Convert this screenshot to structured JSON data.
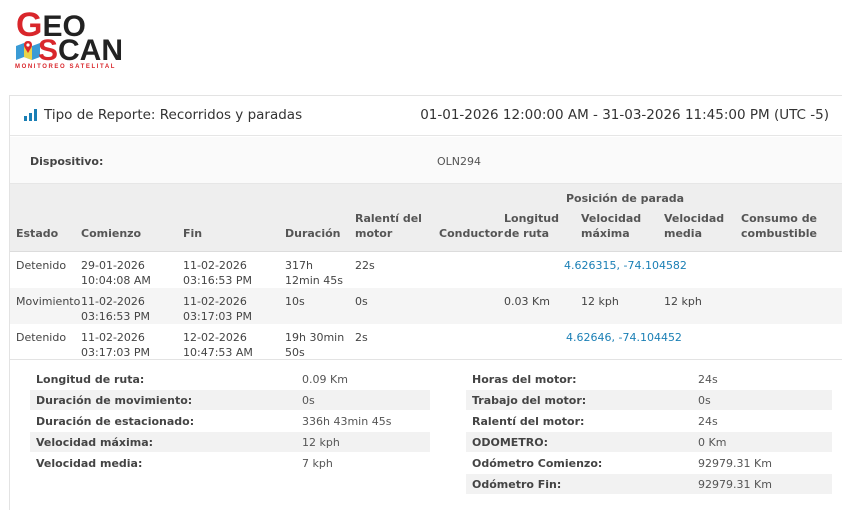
{
  "logo": {
    "line1": "GEO",
    "line2": "SCAN",
    "tagline": "MONITOREO SATELITAL",
    "brand_red": "#d9262b"
  },
  "report": {
    "icon": "bar-chart-icon",
    "title": "Tipo de Reporte: Recorridos y paradas",
    "range": "01-01-2026 12:00:00 AM - 31-03-2026 11:45:00 PM (UTC -5)"
  },
  "device": {
    "label": "Dispositivo:",
    "value": "OLN294"
  },
  "table": {
    "group_header": "Posición de parada",
    "headers": {
      "estado": "Estado",
      "comienzo": "Comienzo",
      "fin": "Fin",
      "duracion": "Duración",
      "ralenti": "Ralentí del motor",
      "conductor": "Conductor",
      "longitud": "Longitud de ruta",
      "vel_max": "Velocidad máxima",
      "vel_media": "Velocidad media",
      "consumo": "Consumo de combustible"
    },
    "rows": [
      {
        "estado": "Detenido",
        "comienzo": "29-01-2026 10:04:08 AM",
        "fin": "11-02-2026 03:16:53 PM",
        "duracion": "317h 12min 45s",
        "ralenti": "22s",
        "posicion": "4.626315, -74.104582"
      },
      {
        "estado": "Movimiento",
        "comienzo": "11-02-2026 03:16:53 PM",
        "fin": "11-02-2026 03:17:03 PM",
        "duracion": "10s",
        "ralenti": "0s",
        "longitud": "0.03 Km",
        "vel_max": "12 kph",
        "vel_media": "12 kph"
      },
      {
        "estado": "Detenido",
        "comienzo": "11-02-2026 03:17:03 PM",
        "fin": "12-02-2026 10:47:53 AM",
        "duracion": "19h 30min 50s",
        "ralenti": "2s",
        "posicion": "4.62646, -74.104452"
      }
    ],
    "link_color": "#1a7fb5"
  },
  "summary_left": [
    {
      "k": "Longitud de ruta:",
      "v": "0.09 Km"
    },
    {
      "k": "Duración de movimiento:",
      "v": "0s"
    },
    {
      "k": "Duración de estacionado:",
      "v": "336h 43min 45s"
    },
    {
      "k": "Velocidad máxima:",
      "v": "12 kph"
    },
    {
      "k": "Velocidad media:",
      "v": "7 kph"
    }
  ],
  "summary_right": [
    {
      "k": "Horas del motor:",
      "v": "24s"
    },
    {
      "k": "Trabajo del motor:",
      "v": "0s"
    },
    {
      "k": "Ralentí del motor:",
      "v": "24s"
    },
    {
      "k": "ODOMETRO:",
      "v": "0 Km"
    },
    {
      "k": "Odómetro Comienzo:",
      "v": "92979.31 Km"
    },
    {
      "k": "Odómetro Fin:",
      "v": "92979.31 Km"
    }
  ]
}
